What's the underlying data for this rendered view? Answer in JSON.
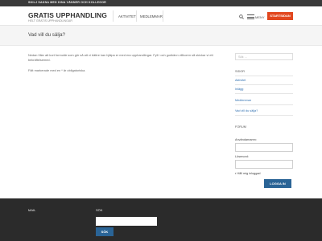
{
  "topbar": {
    "text": "SKILJ SAKNA MED DINA VÄNNER OCH KOLLEGOR"
  },
  "header": {
    "site_title": "GRATIS UPPHANDLING",
    "site_subtitle": "HELT GRATIS UPPHANDLINGAR",
    "nav": [
      {
        "label": "AKTIVITET"
      },
      {
        "label": "MEDLEMMAR"
      }
    ],
    "menu_label": "MENY",
    "start_label": "STARTSIDAN"
  },
  "page": {
    "title": "Vad vill du sälja?",
    "paragraph1": "Nedan fíllar att kort formulär som gör så att vi bättre kan hjälpa er med era upphandlingar. Fyll i och godkänn villkoren så skickar vi ett bekräftelsemed.",
    "paragraph2": "Fält markerade med en * är obligatoriska."
  },
  "sidebar": {
    "search_placeholder": "Sök ...",
    "pages_heading": "SIDOR",
    "pages": [
      {
        "label": "Aktivitet"
      },
      {
        "label": "Inlägg"
      },
      {
        "label": "Medlemmar"
      },
      {
        "label": "Vad vill du sälja?"
      }
    ],
    "forum_heading": "FORUM",
    "username_label": "Användarnamn:",
    "password_label": "Lösenord:",
    "remember_label": "Håll mig inloggad",
    "login_label": "LOGGA IN"
  },
  "footer": {
    "mail_heading": "MAIL",
    "search_heading": "SÖK",
    "search_button": "SÖK"
  },
  "colors": {
    "accent": "#e2471e",
    "link": "#2f6fb0",
    "button": "#2a6496",
    "footer_bg": "#2b2b2b"
  }
}
